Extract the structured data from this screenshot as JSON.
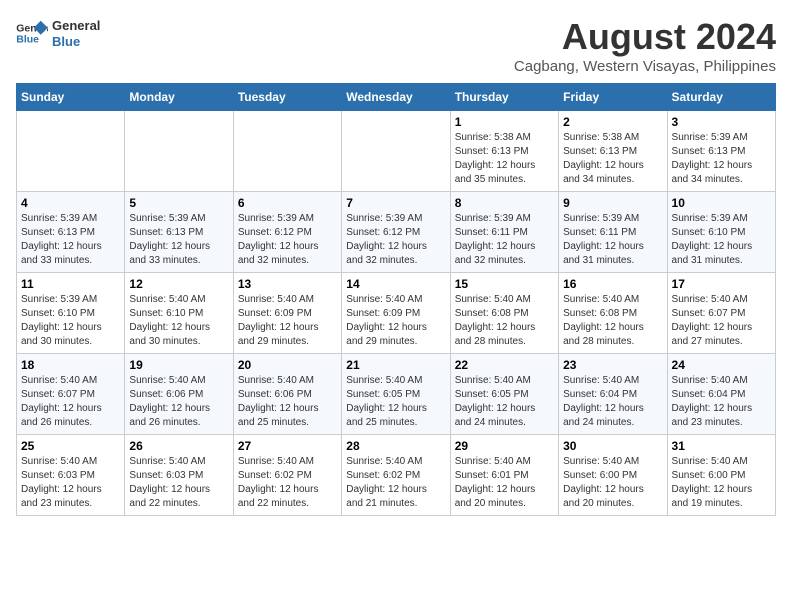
{
  "header": {
    "logo_line1": "General",
    "logo_line2": "Blue",
    "month_title": "August 2024",
    "location": "Cagbang, Western Visayas, Philippines"
  },
  "days_of_week": [
    "Sunday",
    "Monday",
    "Tuesday",
    "Wednesday",
    "Thursday",
    "Friday",
    "Saturday"
  ],
  "weeks": [
    [
      {
        "day": "",
        "info": ""
      },
      {
        "day": "",
        "info": ""
      },
      {
        "day": "",
        "info": ""
      },
      {
        "day": "",
        "info": ""
      },
      {
        "day": "1",
        "info": "Sunrise: 5:38 AM\nSunset: 6:13 PM\nDaylight: 12 hours\nand 35 minutes."
      },
      {
        "day": "2",
        "info": "Sunrise: 5:38 AM\nSunset: 6:13 PM\nDaylight: 12 hours\nand 34 minutes."
      },
      {
        "day": "3",
        "info": "Sunrise: 5:39 AM\nSunset: 6:13 PM\nDaylight: 12 hours\nand 34 minutes."
      }
    ],
    [
      {
        "day": "4",
        "info": "Sunrise: 5:39 AM\nSunset: 6:13 PM\nDaylight: 12 hours\nand 33 minutes."
      },
      {
        "day": "5",
        "info": "Sunrise: 5:39 AM\nSunset: 6:13 PM\nDaylight: 12 hours\nand 33 minutes."
      },
      {
        "day": "6",
        "info": "Sunrise: 5:39 AM\nSunset: 6:12 PM\nDaylight: 12 hours\nand 32 minutes."
      },
      {
        "day": "7",
        "info": "Sunrise: 5:39 AM\nSunset: 6:12 PM\nDaylight: 12 hours\nand 32 minutes."
      },
      {
        "day": "8",
        "info": "Sunrise: 5:39 AM\nSunset: 6:11 PM\nDaylight: 12 hours\nand 32 minutes."
      },
      {
        "day": "9",
        "info": "Sunrise: 5:39 AM\nSunset: 6:11 PM\nDaylight: 12 hours\nand 31 minutes."
      },
      {
        "day": "10",
        "info": "Sunrise: 5:39 AM\nSunset: 6:10 PM\nDaylight: 12 hours\nand 31 minutes."
      }
    ],
    [
      {
        "day": "11",
        "info": "Sunrise: 5:39 AM\nSunset: 6:10 PM\nDaylight: 12 hours\nand 30 minutes."
      },
      {
        "day": "12",
        "info": "Sunrise: 5:40 AM\nSunset: 6:10 PM\nDaylight: 12 hours\nand 30 minutes."
      },
      {
        "day": "13",
        "info": "Sunrise: 5:40 AM\nSunset: 6:09 PM\nDaylight: 12 hours\nand 29 minutes."
      },
      {
        "day": "14",
        "info": "Sunrise: 5:40 AM\nSunset: 6:09 PM\nDaylight: 12 hours\nand 29 minutes."
      },
      {
        "day": "15",
        "info": "Sunrise: 5:40 AM\nSunset: 6:08 PM\nDaylight: 12 hours\nand 28 minutes."
      },
      {
        "day": "16",
        "info": "Sunrise: 5:40 AM\nSunset: 6:08 PM\nDaylight: 12 hours\nand 28 minutes."
      },
      {
        "day": "17",
        "info": "Sunrise: 5:40 AM\nSunset: 6:07 PM\nDaylight: 12 hours\nand 27 minutes."
      }
    ],
    [
      {
        "day": "18",
        "info": "Sunrise: 5:40 AM\nSunset: 6:07 PM\nDaylight: 12 hours\nand 26 minutes."
      },
      {
        "day": "19",
        "info": "Sunrise: 5:40 AM\nSunset: 6:06 PM\nDaylight: 12 hours\nand 26 minutes."
      },
      {
        "day": "20",
        "info": "Sunrise: 5:40 AM\nSunset: 6:06 PM\nDaylight: 12 hours\nand 25 minutes."
      },
      {
        "day": "21",
        "info": "Sunrise: 5:40 AM\nSunset: 6:05 PM\nDaylight: 12 hours\nand 25 minutes."
      },
      {
        "day": "22",
        "info": "Sunrise: 5:40 AM\nSunset: 6:05 PM\nDaylight: 12 hours\nand 24 minutes."
      },
      {
        "day": "23",
        "info": "Sunrise: 5:40 AM\nSunset: 6:04 PM\nDaylight: 12 hours\nand 24 minutes."
      },
      {
        "day": "24",
        "info": "Sunrise: 5:40 AM\nSunset: 6:04 PM\nDaylight: 12 hours\nand 23 minutes."
      }
    ],
    [
      {
        "day": "25",
        "info": "Sunrise: 5:40 AM\nSunset: 6:03 PM\nDaylight: 12 hours\nand 23 minutes."
      },
      {
        "day": "26",
        "info": "Sunrise: 5:40 AM\nSunset: 6:03 PM\nDaylight: 12 hours\nand 22 minutes."
      },
      {
        "day": "27",
        "info": "Sunrise: 5:40 AM\nSunset: 6:02 PM\nDaylight: 12 hours\nand 22 minutes."
      },
      {
        "day": "28",
        "info": "Sunrise: 5:40 AM\nSunset: 6:02 PM\nDaylight: 12 hours\nand 21 minutes."
      },
      {
        "day": "29",
        "info": "Sunrise: 5:40 AM\nSunset: 6:01 PM\nDaylight: 12 hours\nand 20 minutes."
      },
      {
        "day": "30",
        "info": "Sunrise: 5:40 AM\nSunset: 6:00 PM\nDaylight: 12 hours\nand 20 minutes."
      },
      {
        "day": "31",
        "info": "Sunrise: 5:40 AM\nSunset: 6:00 PM\nDaylight: 12 hours\nand 19 minutes."
      }
    ]
  ]
}
